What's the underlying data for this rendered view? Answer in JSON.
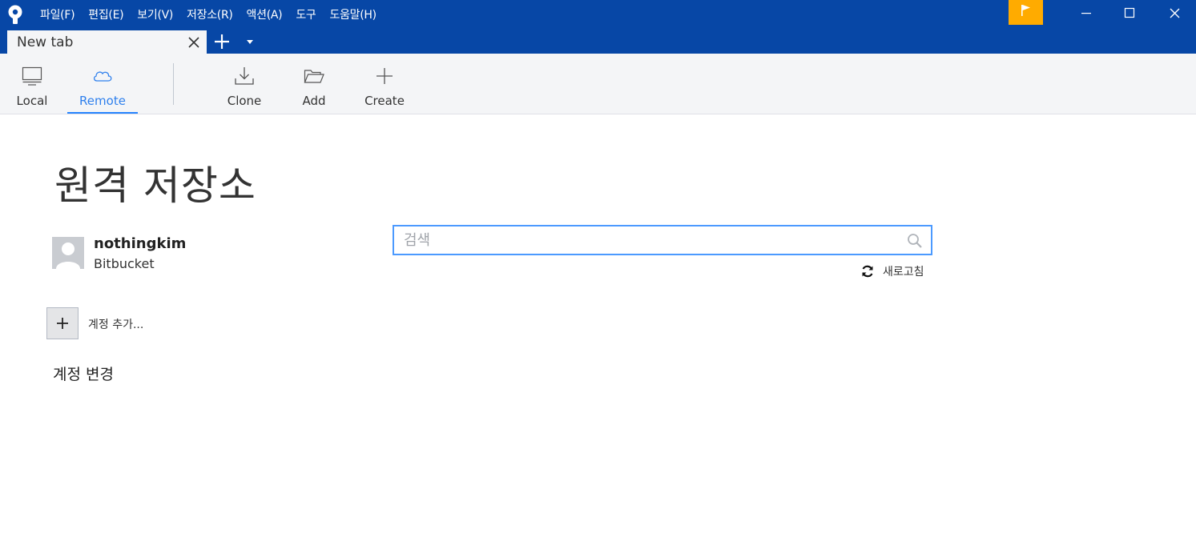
{
  "menu": [
    "파일(F)",
    "편집(E)",
    "보기(V)",
    "저장소(R)",
    "액션(A)",
    "도구",
    "도움말(H)"
  ],
  "tabs": {
    "active_label": "New tab"
  },
  "toolbar": {
    "local_label": "Local",
    "remote_label": "Remote",
    "clone_label": "Clone",
    "add_label": "Add",
    "create_label": "Create"
  },
  "main": {
    "title": "원격 저장소",
    "account": {
      "name": "nothingkim",
      "service": "Bitbucket"
    },
    "add_account_label": "계정 추가...",
    "switch_account_label": "계정 변경",
    "search": {
      "placeholder": "검색",
      "value": ""
    },
    "refresh_label": "새로고침"
  },
  "colors": {
    "titlebar": "#0747a6",
    "flag": "#ffab00",
    "accent": "#2684ff"
  }
}
